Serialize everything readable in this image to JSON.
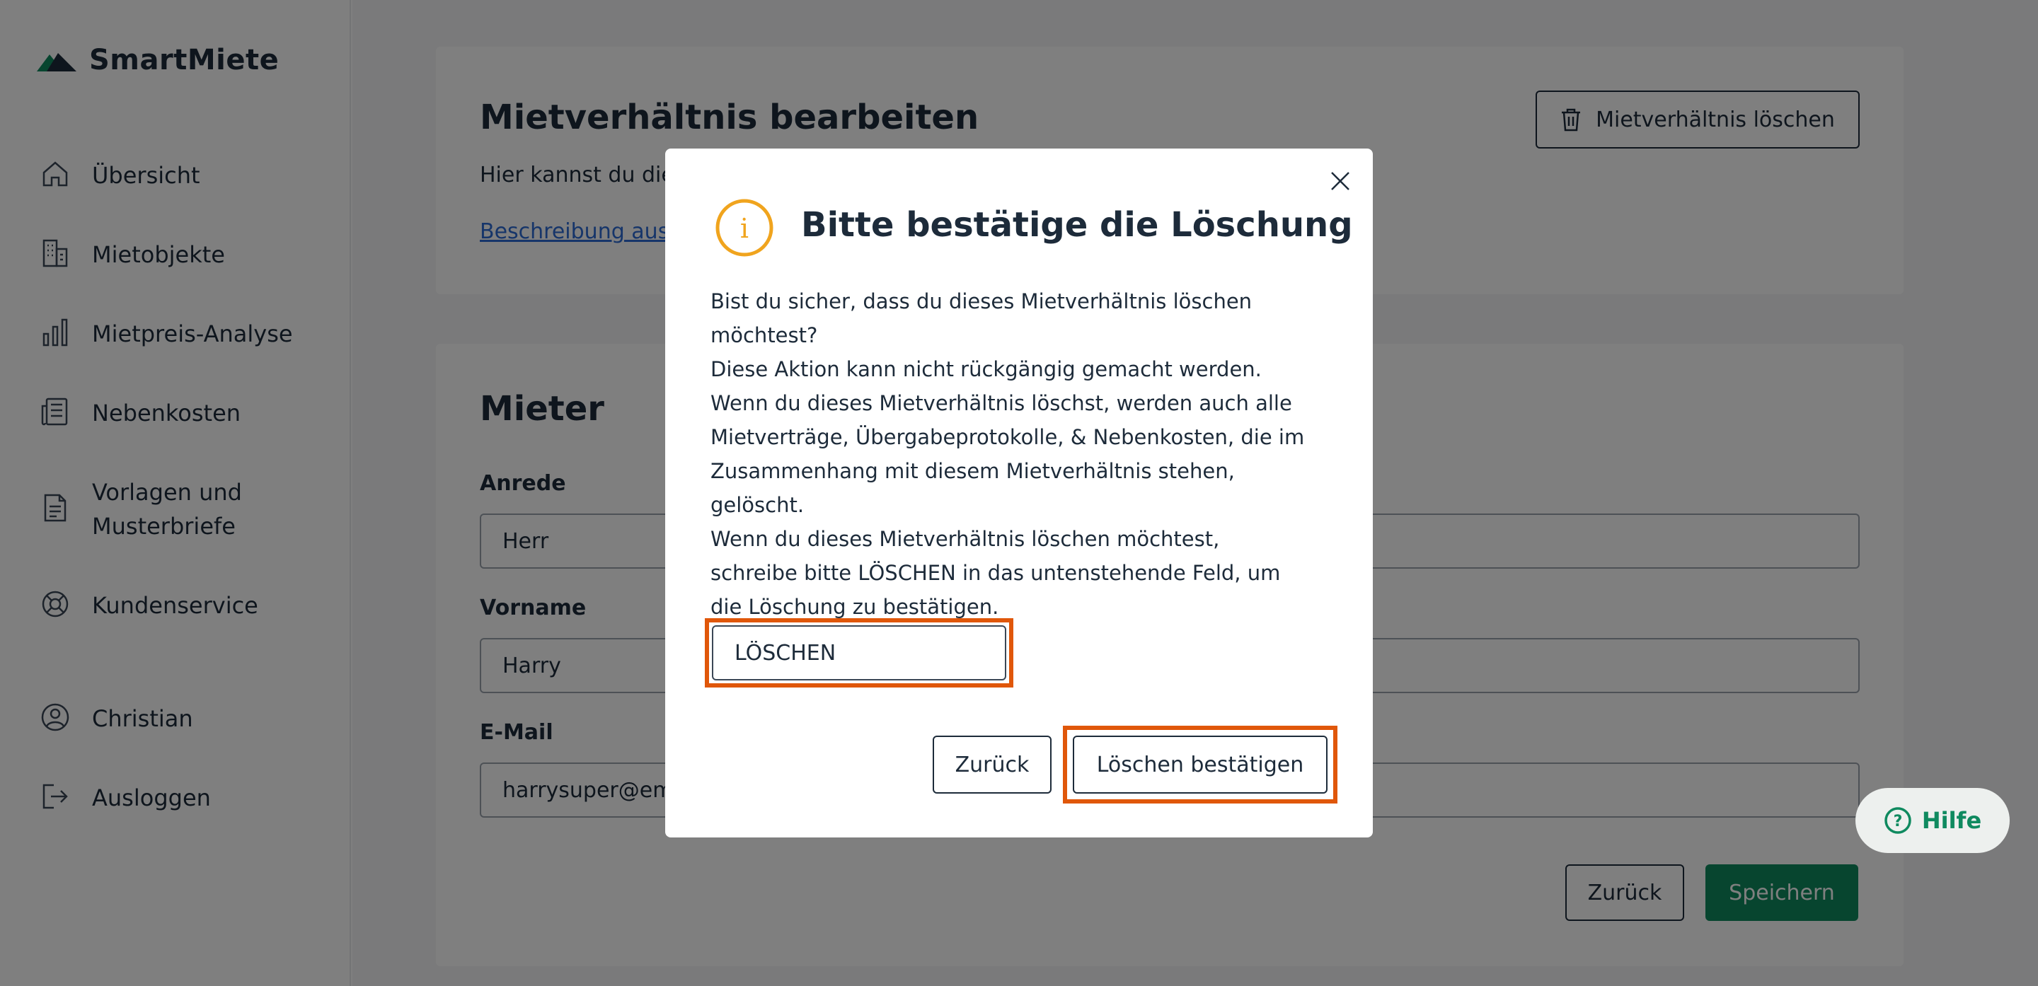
{
  "app": {
    "name": "SmartMiete"
  },
  "colors": {
    "brand": "#0f8a5f",
    "highlight": "#e0570a",
    "warning": "#f0a41e",
    "link": "#2c6bd4"
  },
  "sidebar": {
    "items": [
      {
        "label": "Übersicht",
        "icon": "home-icon"
      },
      {
        "label": "Mietobjekte",
        "icon": "building-icon"
      },
      {
        "label": "Mietpreis-Analyse",
        "icon": "bar-chart-icon"
      },
      {
        "label": "Nebenkosten",
        "icon": "receipt-icon"
      },
      {
        "label_line1": "Vorlagen und",
        "label_line2": "Musterbriefe",
        "icon": "document-icon"
      },
      {
        "label": "Kundenservice",
        "icon": "lifebuoy-icon"
      },
      {
        "label": "Christian",
        "icon": "user-icon"
      },
      {
        "label": "Ausloggen",
        "icon": "logout-icon"
      }
    ]
  },
  "main": {
    "header": {
      "title": "Mietverhältnis bearbeiten",
      "description_visible": "Hier kannst du die",
      "link_visible": "Beschreibung aus",
      "delete_button": "Mietverhältnis löschen"
    },
    "tenant": {
      "title": "Mieter",
      "salutation_label": "Anrede",
      "salutation_value": "Herr",
      "firstname_label": "Vorname",
      "firstname_value": "Harry",
      "email_label": "E-Mail",
      "email_value_visible": "harrysuper@em",
      "back_button": "Zurück",
      "save_button": "Speichern"
    }
  },
  "modal": {
    "title": "Bitte bestätige die Löschung",
    "body": [
      "Bist du sicher, dass du dieses Mietverhältnis löschen",
      "möchtest?",
      "Diese Aktion kann nicht rückgängig gemacht werden.",
      "Wenn du dieses Mietverhältnis löschst, werden auch alle",
      "Mietverträge, Übergabeprotokolle, & Nebenkosten, die im",
      "Zusammenhang mit diesem Mietverhältnis stehen,",
      "gelöscht.",
      "Wenn du dieses Mietverhältnis löschen möchtest,",
      "schreibe bitte LÖSCHEN in das untenstehende Feld, um",
      "die Löschung zu bestätigen."
    ],
    "confirm_input_value": "LÖSCHEN",
    "back_button": "Zurück",
    "confirm_button": "Löschen bestätigen"
  },
  "help": {
    "label": "Hilfe"
  }
}
